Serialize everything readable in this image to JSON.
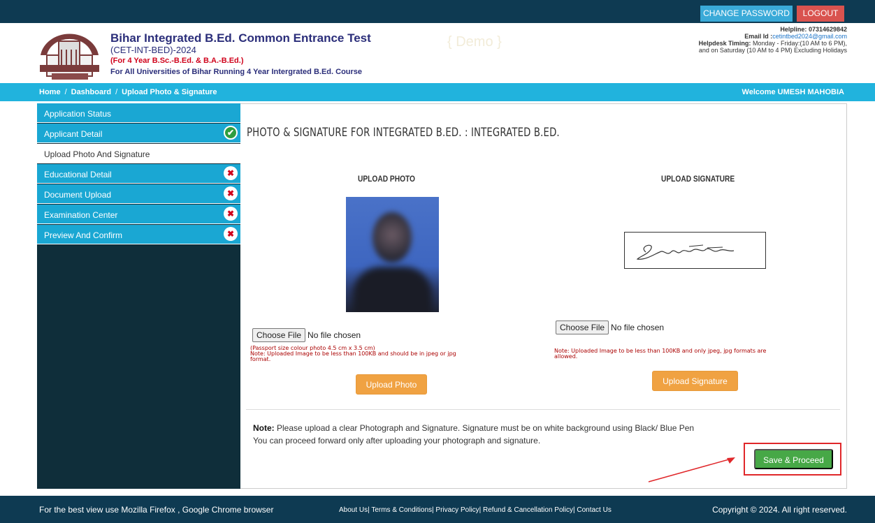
{
  "topbar": {
    "change_password": "CHANGE PASSWORD",
    "logout": "LOGOUT"
  },
  "header": {
    "title": "Bihar Integrated B.Ed. Common Entrance Test",
    "subtitle": "(CET-INT-BED)-2024",
    "course": "(For 4 Year B.Sc.-B.Ed. & B.A.-B.Ed.)",
    "universities": "For All Universities of Bihar Running 4 Year Intergrated B.Ed. Course",
    "demo": "{ Demo }",
    "helpline_label": "Helpline:",
    "helpline_value": "07314629842",
    "email_label": "Email Id :",
    "email_value": "cetintbed2024@gmail.com",
    "timing_label": "Helpdesk Timing:",
    "timing_value": "Monday - Friday:(10 AM to 6 PM),",
    "timing_value2": "and on Saturday (10 AM to 4 PM) Excluding Holidays"
  },
  "breadcrumb": {
    "home": "Home",
    "dashboard": "Dashboard",
    "current": "Upload Photo & Signature",
    "welcome": "Welcome UMESH MAHOBIA"
  },
  "sidebar": {
    "items": [
      {
        "label": "Application Status"
      },
      {
        "label": "Applicant Detail",
        "status": "✔"
      },
      {
        "label": "Upload Photo And Signature"
      },
      {
        "label": "Educational Detail",
        "status": "✖"
      },
      {
        "label": "Document Upload",
        "status": "✖"
      },
      {
        "label": "Examination Center",
        "status": "✖"
      },
      {
        "label": "Preview And Confirm",
        "status": "✖"
      }
    ]
  },
  "main": {
    "heading": "PHOTO & SIGNATURE FOR INTEGRATED B.ED. : INTEGRATED B.ED.",
    "photo": {
      "title": "UPLOAD PHOTO",
      "choose": "Choose File",
      "no_file": "No file chosen",
      "note1": "(Passport size colour photo 4.5 cm x 3.5 cm)",
      "note2": "Note: Uploaded Image to be less than 100KB and should be in jpeg or jpg",
      "note3": "format.",
      "button": "Upload Photo"
    },
    "signature": {
      "title": "UPLOAD SIGNATURE",
      "choose": "Choose File",
      "no_file": "No file chosen",
      "note1": "Note: Uploaded Image to be less than 100KB and only jpeg, jpg formats are",
      "note2": "allowed.",
      "button": "Upload Signature"
    },
    "note_label": "Note:",
    "note_text": "Please upload a clear Photograph and Signature. Signature must be on white background using Black/ Blue Pen",
    "note_text2": "You can proceed forward only after uploading your photograph and signature.",
    "proceed": "Save & Proceed"
  },
  "footer": {
    "left": "For the best view use Mozilla Firefox , Google Chrome browser",
    "links": "About Us| Terms & Conditions| Privacy Policy| Refund & Cancellation Policy| Contact Us",
    "right": "Copyright © 2024. All right reserved."
  }
}
